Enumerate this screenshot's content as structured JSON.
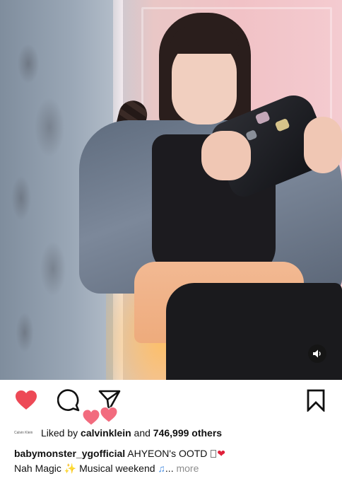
{
  "post": {
    "media": {
      "type": "video",
      "sound_icon": "speaker-icon"
    },
    "actions": {
      "like_icon": "heart-filled-icon",
      "comment_icon": "comment-bubble-icon",
      "share_icon": "paper-plane-icon",
      "save_icon": "bookmark-icon",
      "like_color": "#ED4956"
    },
    "likes": {
      "avatar_text": "Calvin Klein",
      "prefix": "Liked by ",
      "user": "calvinklein",
      "middle": " and ",
      "count": "746,999 others"
    },
    "caption": {
      "username": "babymonster_ygofficial",
      "text_line1": " AHYEON's OOTD ",
      "text_line2_a": "Nah Magic ",
      "text_line2_b": " Musical weekend ",
      "ellipsis": "... ",
      "more": "more"
    }
  }
}
